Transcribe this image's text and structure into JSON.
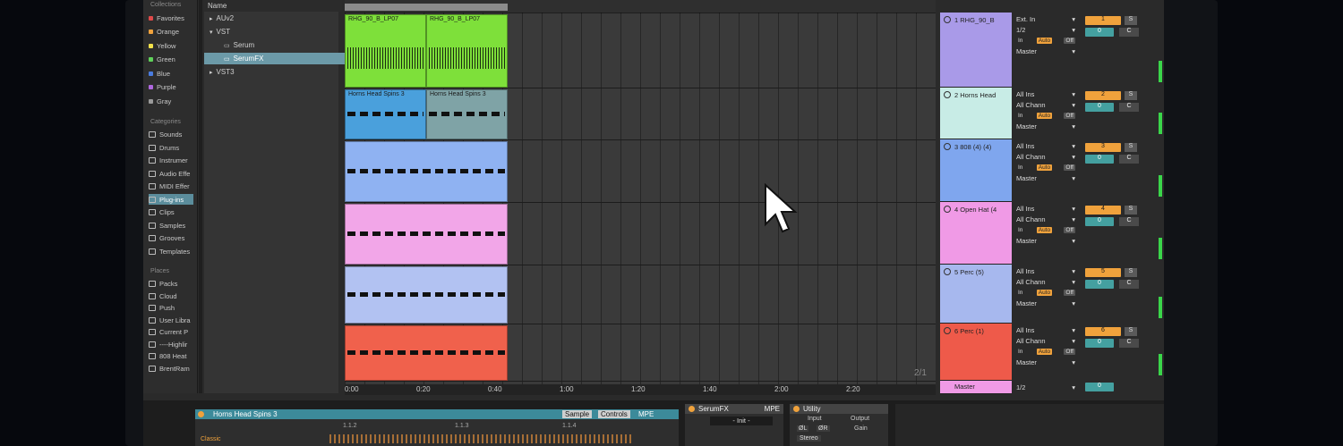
{
  "sidebar": {
    "collections_header": "Collections",
    "collections": [
      {
        "label": "Favorites",
        "color": "#e04a4a"
      },
      {
        "label": "Orange",
        "color": "#f0a23c"
      },
      {
        "label": "Yellow",
        "color": "#f2e14a"
      },
      {
        "label": "Green",
        "color": "#5fd25a"
      },
      {
        "label": "Blue",
        "color": "#4a7ce0"
      },
      {
        "label": "Purple",
        "color": "#b068e0"
      },
      {
        "label": "Gray",
        "color": "#9a9a9a"
      }
    ],
    "categories_header": "Categories",
    "categories": [
      {
        "label": "Sounds",
        "icon": "sounds-icon"
      },
      {
        "label": "Drums",
        "icon": "drums-icon"
      },
      {
        "label": "Instrumer",
        "icon": "instruments-icon"
      },
      {
        "label": "Audio Effe",
        "icon": "audio-effects-icon"
      },
      {
        "label": "MIDI Effer",
        "icon": "midi-effects-icon"
      },
      {
        "label": "Plug-ins",
        "icon": "plugins-icon",
        "selected": true
      },
      {
        "label": "Clips",
        "icon": "clips-icon"
      },
      {
        "label": "Samples",
        "icon": "samples-icon"
      },
      {
        "label": "Grooves",
        "icon": "grooves-icon"
      },
      {
        "label": "Templates",
        "icon": "templates-icon"
      }
    ],
    "places_header": "Places",
    "places": [
      {
        "label": "Packs",
        "icon": "packs-icon"
      },
      {
        "label": "Cloud",
        "icon": "cloud-icon"
      },
      {
        "label": "Push",
        "icon": "push-icon"
      },
      {
        "label": "User Libra",
        "icon": "user-library-icon"
      },
      {
        "label": "Current P",
        "icon": "folder-icon"
      },
      {
        "label": "----Highlir",
        "icon": "folder-icon"
      },
      {
        "label": "808 Heat",
        "icon": "folder-icon"
      },
      {
        "label": "BrentRam",
        "icon": "folder-icon"
      }
    ]
  },
  "filepane": {
    "header": "Name",
    "rows": [
      {
        "label": "AUv2",
        "indent": 0,
        "arrow": "▸"
      },
      {
        "label": "VST",
        "indent": 0,
        "arrow": "▾"
      },
      {
        "label": "Serum",
        "indent": 2,
        "arrow": ""
      },
      {
        "label": "SerumFX",
        "indent": 2,
        "arrow": "",
        "selected": true
      },
      {
        "label": "VST3",
        "indent": 0,
        "arrow": "▸"
      }
    ]
  },
  "tracks": [
    {
      "name": "1 RHG_90_B",
      "color": "#a99ae8",
      "clip_color": "#7ee03a",
      "clips": [
        "RHG_90_B_LP07",
        "RHG_90_B_LP07"
      ],
      "input": "Ext. In",
      "channel": "1/2",
      "number": "1",
      "pan": "0",
      "pan_c": "C"
    },
    {
      "name": "2 Horns Head",
      "color": "#c8ece6",
      "clip_color": "#4aa0dc",
      "clips": [
        "Horns Head Spins 3",
        "Horns Head Spins 3"
      ],
      "input": "All Ins",
      "channel": "All Chann",
      "number": "2",
      "pan": "0",
      "pan_c": "C"
    },
    {
      "name": "3 808 (4) (4)",
      "color": "#7fa6ee",
      "clip_color": "#8fb2f2",
      "clips": [],
      "input": "All Ins",
      "channel": "All Chann",
      "number": "3",
      "pan": "0",
      "pan_c": "C"
    },
    {
      "name": "4 Open Hat (4",
      "color": "#f09ae6",
      "clip_color": "#f2a6e8",
      "clips": [],
      "input": "All Ins",
      "channel": "All Chann",
      "number": "4",
      "pan": "0",
      "pan_c": "C"
    },
    {
      "name": "5 Perc (5)",
      "color": "#a7b8ee",
      "clip_color": "#b2c2f2",
      "clips": [],
      "input": "All Ins",
      "channel": "All Chann",
      "number": "5",
      "pan": "0",
      "pan_c": "C"
    },
    {
      "name": "6 Perc (1)",
      "color": "#ee5a4a",
      "clip_color": "#f0614c",
      "clips": [],
      "input": "All Ins",
      "channel": "All Chann",
      "number": "6",
      "pan": "0",
      "pan_c": "C"
    }
  ],
  "master": {
    "name": "Master",
    "channel": "1/2",
    "pan": "0"
  },
  "monitor": {
    "in": "In",
    "auto": "Auto",
    "off": "Off",
    "out": "Master"
  },
  "timeline": {
    "labels": [
      "0:00",
      "0:20",
      "0:40",
      "1:00",
      "1:20",
      "1:40",
      "2:00",
      "2:20"
    ],
    "counter": "2/1"
  },
  "clip_view": {
    "title": "Horns Head Spins 3",
    "sample_tab": "Sample",
    "controls_tab": "Controls",
    "mpe": "MPE",
    "markers": [
      "1.1.2",
      "1.1.3",
      "1.1.4"
    ],
    "warp_mode": "Classic"
  },
  "serum_device": {
    "title": "SerumFX",
    "mpe": "MPE",
    "preset": "- Init -"
  },
  "utility_device": {
    "title": "Utility",
    "input": "Input",
    "output": "Output",
    "gain": "Gain",
    "phase_l": "ØL",
    "phase_r": "ØR",
    "mode": "Stereo"
  }
}
